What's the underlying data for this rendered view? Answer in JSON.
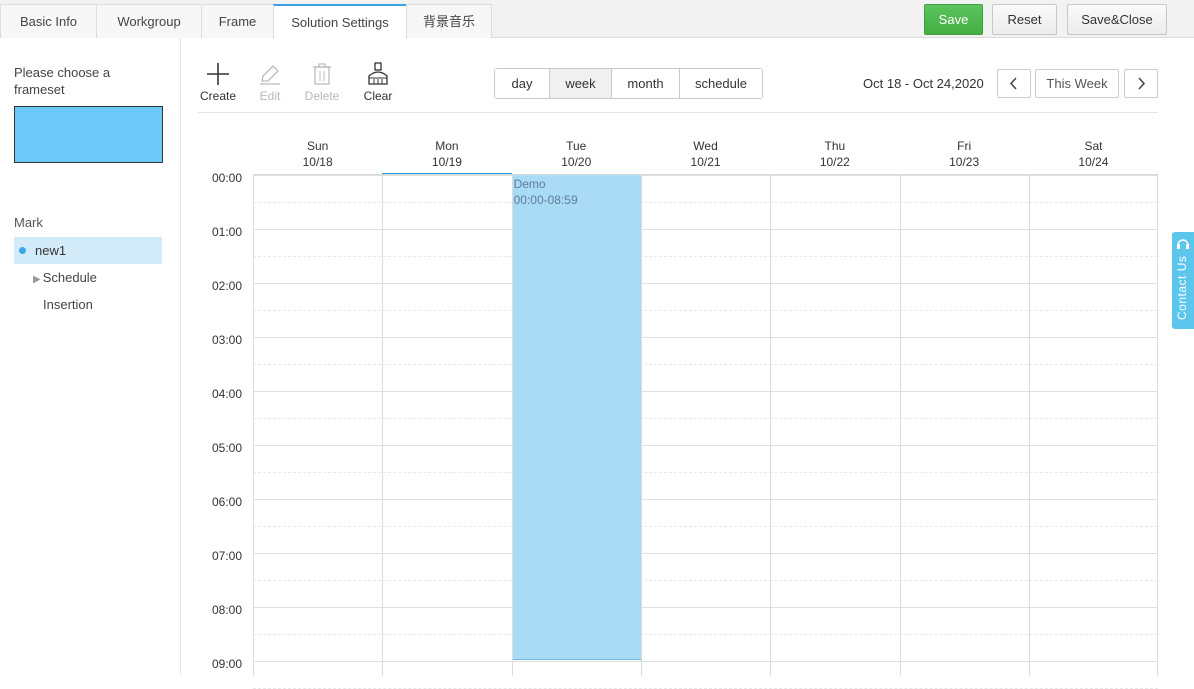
{
  "tabs": [
    {
      "label": "Basic Info",
      "active": false
    },
    {
      "label": "Workgroup",
      "active": false
    },
    {
      "label": "Frame",
      "active": false
    },
    {
      "label": "Solution Settings",
      "active": true
    },
    {
      "label": "背景音乐",
      "active": false
    }
  ],
  "actions": {
    "save": "Save",
    "reset": "Reset",
    "save_close": "Save&Close"
  },
  "left": {
    "frameset_label": "Please choose a frameset",
    "mark_label": "Mark",
    "mark_item": "new1",
    "schedule": "Schedule",
    "insertion": "Insertion"
  },
  "toolbar": {
    "create": "Create",
    "edit": "Edit",
    "delete": "Delete",
    "clear": "Clear"
  },
  "views": [
    "day",
    "week",
    "month",
    "schedule"
  ],
  "active_view": "week",
  "date_range": "Oct 18 - Oct 24,2020",
  "this_week": "This Week",
  "days": [
    {
      "name": "Sun",
      "date": "10/18"
    },
    {
      "name": "Mon",
      "date": "10/19"
    },
    {
      "name": "Tue",
      "date": "10/20"
    },
    {
      "name": "Wed",
      "date": "10/21"
    },
    {
      "name": "Thu",
      "date": "10/22"
    },
    {
      "name": "Fri",
      "date": "10/23"
    },
    {
      "name": "Sat",
      "date": "10/24"
    }
  ],
  "today_index": 1,
  "hours": [
    "00:00",
    "01:00",
    "02:00",
    "03:00",
    "04:00",
    "05:00",
    "06:00",
    "07:00",
    "08:00",
    "09:00"
  ],
  "event": {
    "title": "Demo",
    "time": "00:00-08:59",
    "day_index": 2
  },
  "contact": "Contact Us",
  "colors": {
    "accent": "#3aa0e0",
    "save": "#4cb24c",
    "event": "#a9daf6",
    "frameset": "#6cc8f8",
    "contact": "#5cc6ec"
  }
}
